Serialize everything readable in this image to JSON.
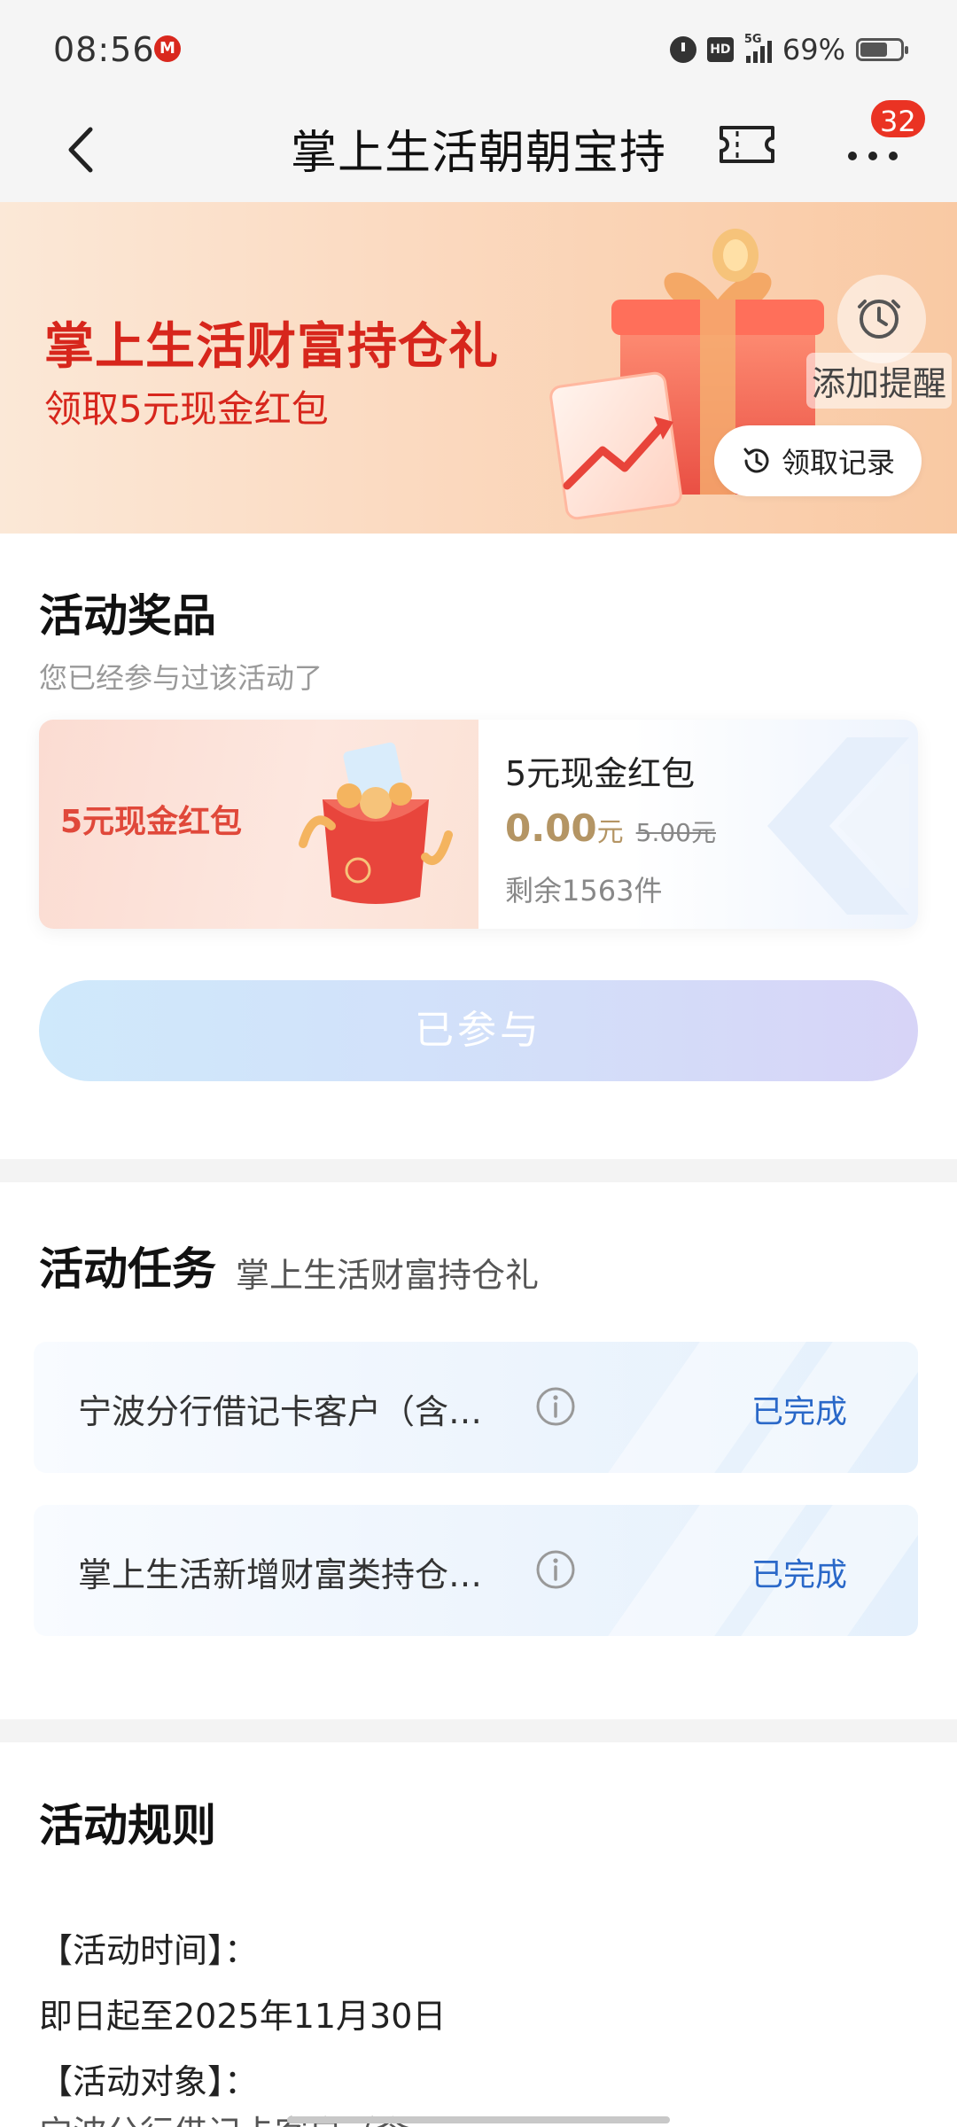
{
  "status_bar": {
    "time": "08:56",
    "app_icon_glyph": "M",
    "icons": [
      "alarm-icon",
      "hd-icon",
      "5g-signal-icon",
      "battery-icon"
    ],
    "hd_label": "HD",
    "network_label": "5G",
    "battery_percent": "69%",
    "battery_level": 0.69
  },
  "nav": {
    "title": "掌上生活朝朝宝持",
    "more_badge": "32",
    "icons": [
      "back-arrow-icon",
      "ticket-icon",
      "more-icon"
    ]
  },
  "banner": {
    "title": "掌上生活财富持仓礼",
    "subtitle": "领取5元现金红包",
    "remind_label": "添加提醒",
    "record_label": "领取记录",
    "colors": {
      "accent": "#d7261c"
    }
  },
  "prizes": {
    "title": "活动奖品",
    "note": "您已经参与过该活动了",
    "card": {
      "left_label": "5元现金红包",
      "name": "5元现金红包",
      "price": "0.00",
      "price_unit": "元",
      "original_price": "5.00元",
      "stock": "剩余1563件"
    },
    "join_button": "已参与"
  },
  "tasks": {
    "title": "活动任务",
    "subtitle": "掌上生活财富持仓礼",
    "items": [
      {
        "label": "宁波分行借记卡客户（含…",
        "status": "已完成"
      },
      {
        "label": "掌上生活新增财富类持仓…",
        "status": "已完成"
      }
    ],
    "status_color": "#2a68c8"
  },
  "rules": {
    "title": "活动规则",
    "lines": [
      "【活动时间】：",
      "即日起至2025年11月30日",
      "【活动对象】："
    ],
    "partial_line": "宁波分行借记卡客户（含…"
  }
}
